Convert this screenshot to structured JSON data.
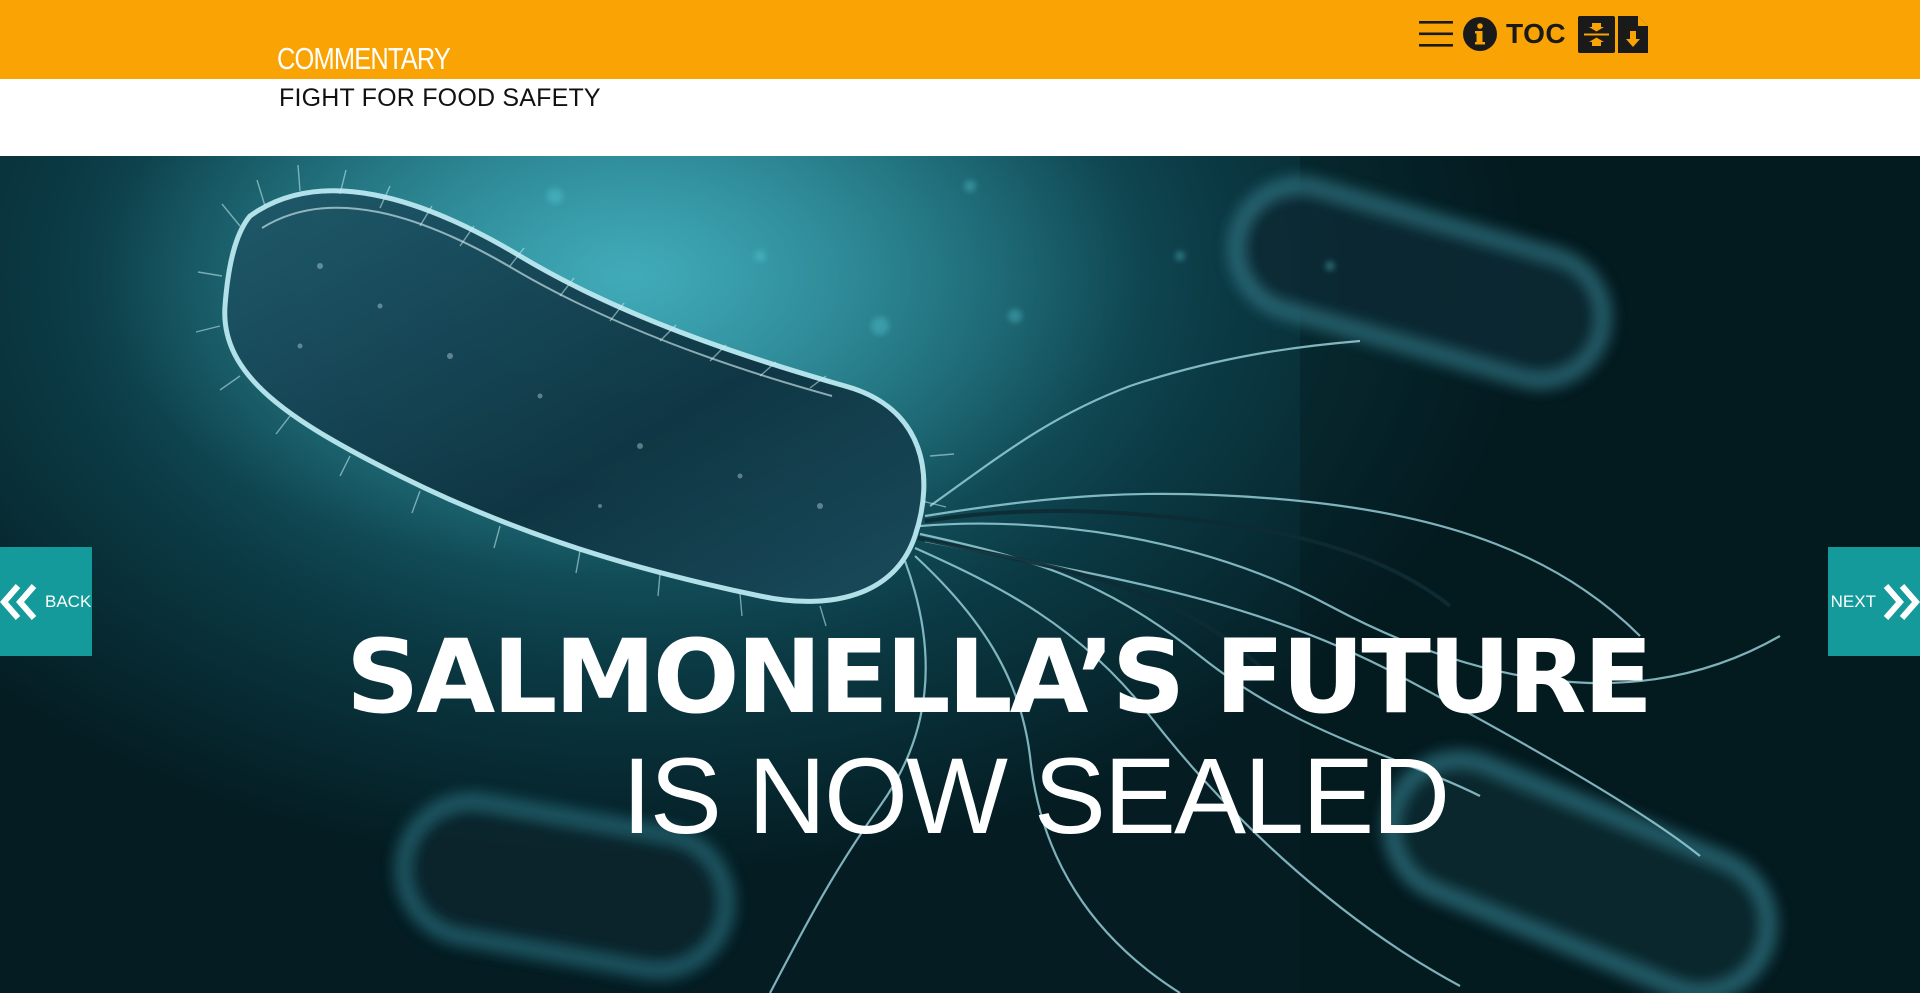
{
  "header": {
    "section_label": "COMMENTARY",
    "toc_label": "TOC",
    "icons": [
      "menu-icon",
      "info-icon",
      "fit-page-icon",
      "pdf-download-icon"
    ],
    "accent_color": "#f9a305"
  },
  "article": {
    "kicker": "FIGHT FOR FOOD SAFETY",
    "headline_line1": "SALMONELLA’S FUTURE",
    "headline_line2": "IS NOW SEALED"
  },
  "navigation": {
    "back_label": "BACK",
    "next_label": "NEXT",
    "button_color": "#149a9a"
  }
}
